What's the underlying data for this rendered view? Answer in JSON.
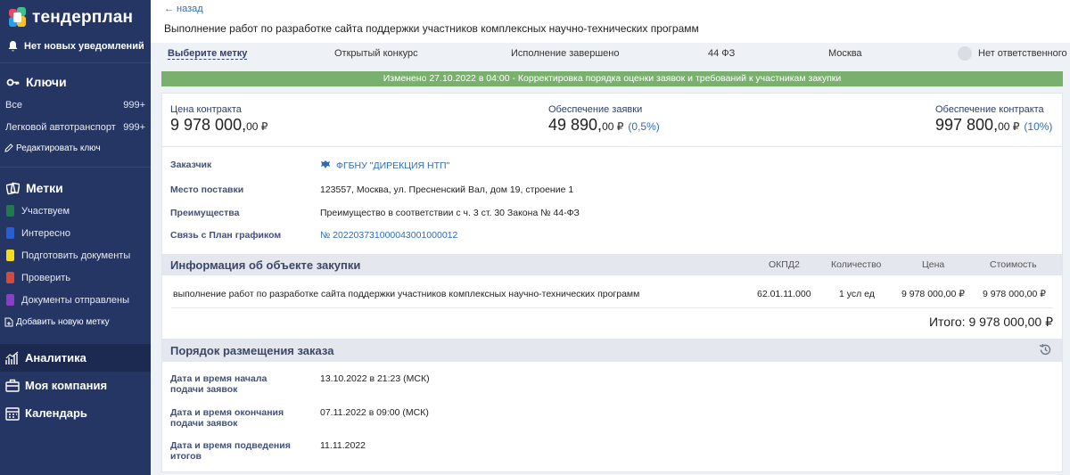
{
  "app": {
    "logo_text": "тендерплан"
  },
  "sidebar": {
    "notifications": "Нет новых уведомлений",
    "keys": {
      "title": "Ключи",
      "items": [
        {
          "label": "Все",
          "count": "999+"
        },
        {
          "label": "Легковой автотранспорт",
          "count": "999+"
        }
      ],
      "edit": "Редактировать ключ"
    },
    "tags": {
      "title": "Метки",
      "items": [
        {
          "label": "Участвуем",
          "color": "#1f7a4c"
        },
        {
          "label": "Интересно",
          "color": "#2160d6"
        },
        {
          "label": "Подготовить документы",
          "color": "#f4dc18"
        },
        {
          "label": "Проверить",
          "color": "#d64a3a"
        },
        {
          "label": "Документы отправлены",
          "color": "#8a3fc7"
        }
      ],
      "add": "Добавить новую метку"
    },
    "nav": [
      {
        "label": "Аналитика"
      },
      {
        "label": "Моя компания"
      },
      {
        "label": "Календарь"
      }
    ]
  },
  "header": {
    "back": "← назад",
    "title": "Выполнение работ по разработке сайта поддержки участников комплексных научно-технических программ"
  },
  "infobar": {
    "pick_label": "Выберите метку",
    "procedure": "Открытый конкурс",
    "status": "Исполнение завершено",
    "law": "44 ФЗ",
    "region": "Москва",
    "responsible": "Нет ответственного"
  },
  "changed_banner": "Изменено 27.10.2022 в 04:00 - Корректировка порядка оценки заявок и требований к участникам закупки",
  "money": {
    "contract": {
      "label": "Цена контракта",
      "main": "9 978 000,",
      "tail": "00 ₽"
    },
    "bid": {
      "label": "Обеспечение заявки",
      "main": "49 890,",
      "tail": "00 ₽",
      "pct": "(0,5%)"
    },
    "contract_sec": {
      "label": "Обеспечение контракта",
      "main": "997 800,",
      "tail": "00 ₽",
      "pct": "(10%)"
    }
  },
  "details": {
    "customer_k": "Заказчик",
    "customer_v": "ФГБНУ \"ДИРЕКЦИЯ НТП\"",
    "place_k": "Место поставки",
    "place_v": "123557, Москва, ул. Пресненский Вал, дом 19, строение 1",
    "adv_k": "Преимущества",
    "adv_v": "Преимущество в соответствии с ч. 3 ст. 30 Закона № 44-ФЗ",
    "plan_k": "Связь с План графиком",
    "plan_v": "№ 202203731000043001000012"
  },
  "object_info": {
    "title": "Информация об объекте закупки",
    "columns": {
      "okpd": "ОКПД2",
      "qty": "Количество",
      "price": "Цена",
      "cost": "Стоимость"
    },
    "row": {
      "name": "выполнение работ по разработке сайта поддержки участников комплексных научно-технических программ",
      "okpd": "62.01.11.000",
      "qty": "1 усл ед",
      "price": "9 978 000,00 ₽",
      "cost": "9 978 000,00 ₽"
    },
    "total": "Итого: 9 978 000,00 ₽"
  },
  "order": {
    "title": "Порядок размещения заказа",
    "start_k": "Дата и время начала подачи заявок",
    "start_v": "13.10.2022 в 21:23 (МСК)",
    "end_k": "Дата и время окончания подачи заявок",
    "end_v": "07.11.2022 в 09:00 (МСК)",
    "result_k": "Дата и время подведения итогов",
    "result_v": "11.11.2022"
  }
}
